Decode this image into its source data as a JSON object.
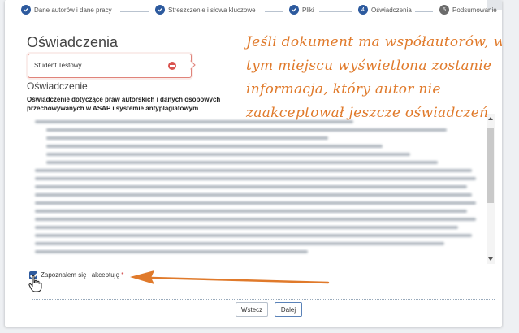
{
  "stepper": [
    {
      "label": "Dane autorów i dane pracy",
      "marker": "✔",
      "state": "done"
    },
    {
      "label": "Streszczenie i słowa kluczowe",
      "marker": "✔",
      "state": "done"
    },
    {
      "label": "Pliki",
      "marker": "✔",
      "state": "done"
    },
    {
      "label": "Oświadczenia",
      "marker": "4",
      "state": "current"
    },
    {
      "label": "Podsumowanie",
      "marker": "5",
      "state": "pending"
    }
  ],
  "page_title": "Oświadczenia",
  "student": {
    "name": "Student Testowy",
    "remove_icon": "minus-circle-icon"
  },
  "section_title": "Oświadczenie",
  "section_desc": "Oświadczenie dotyczące praw autorskich i danych osobowych przechowywanych w ASAP i systemie antyplagiatowym",
  "checkbox": {
    "label": "Zapoznałem się i akceptuję",
    "required_mark": "*",
    "checked": true
  },
  "annotation": "Jeśli dokument ma współautorów, w tym miejscu wyświetlona zostanie informacja, który autor nie zaakceptował jeszcze oświadczeń",
  "buttons": {
    "prev": "Wstecz",
    "next": "Dalej"
  },
  "colors": {
    "accent": "#2d5a9e",
    "annotation": "#e07a2b",
    "error": "#d9534f"
  }
}
